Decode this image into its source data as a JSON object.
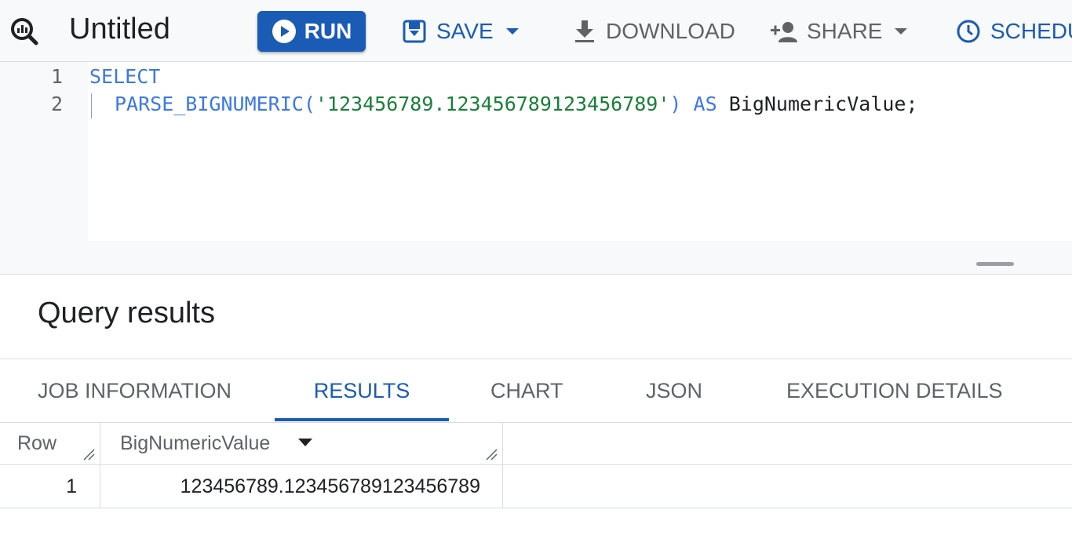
{
  "toolbar": {
    "title": "Untitled",
    "run_label": "RUN",
    "save_label": "SAVE",
    "download_label": "DOWNLOAD",
    "share_label": "SHARE",
    "schedule_label": "SCHEDU",
    "accent_color": "#1a5bb5",
    "icons": [
      "query-icon",
      "play-icon",
      "save-icon",
      "download-icon",
      "add-person-icon",
      "clock-icon",
      "caret-down-icon"
    ]
  },
  "editor": {
    "lines": [
      {
        "number": "1",
        "keyword": "SELECT"
      },
      {
        "number": "2",
        "function": "PARSE_BIGNUMERIC(",
        "string": "'123456789.123456789123456789'",
        "close": ")",
        "as_keyword": "AS",
        "alias": "BigNumericValue;"
      }
    ]
  },
  "results": {
    "heading": "Query results",
    "tabs": [
      {
        "label": "JOB INFORMATION"
      },
      {
        "label": "RESULTS",
        "active": true
      },
      {
        "label": "CHART"
      },
      {
        "label": "JSON"
      },
      {
        "label": "EXECUTION DETAILS"
      }
    ],
    "table": {
      "columns": [
        "Row",
        "BigNumericValue"
      ],
      "rows": [
        {
          "row": "1",
          "value": "123456789.123456789123456789"
        }
      ]
    }
  }
}
